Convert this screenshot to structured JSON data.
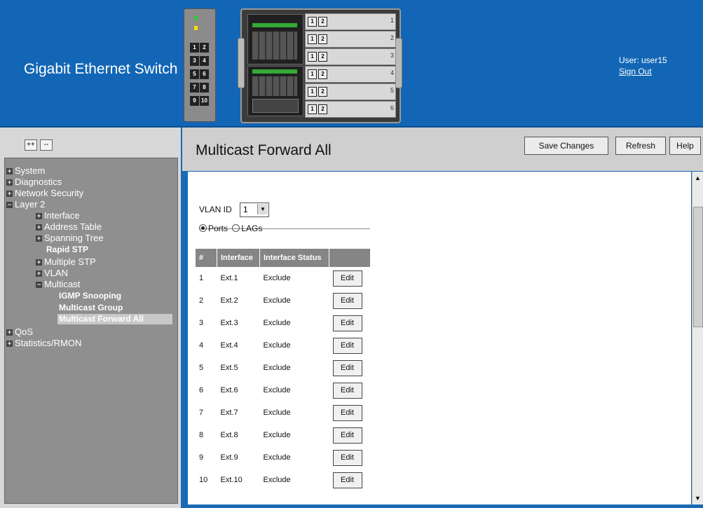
{
  "header": {
    "title": "Gigabit Ethernet Switch",
    "user_label": "User: user15",
    "sign_out": "Sign Out"
  },
  "switch_module": {
    "port_numbers": [
      "1",
      "2",
      "3",
      "4",
      "5",
      "6",
      "7",
      "8",
      "9",
      "10"
    ],
    "slot_numbers": [
      "1",
      "2",
      "3",
      "4",
      "5",
      "6"
    ]
  },
  "sidebar": {
    "expand_all": "++",
    "collapse_all": "--",
    "items": [
      {
        "label": "System",
        "sign": "+"
      },
      {
        "label": "Diagnostics",
        "sign": "+"
      },
      {
        "label": "Network Security",
        "sign": "+"
      },
      {
        "label": "Layer 2",
        "sign": "−"
      },
      {
        "label": "Interface",
        "sign": "+"
      },
      {
        "label": "Address Table",
        "sign": "+"
      },
      {
        "label": "Spanning Tree",
        "sign": "+"
      },
      {
        "label": "Rapid STP"
      },
      {
        "label": "Multiple STP",
        "sign": "+"
      },
      {
        "label": "VLAN",
        "sign": "+"
      },
      {
        "label": "Multicast",
        "sign": "−"
      },
      {
        "label": "IGMP Snooping"
      },
      {
        "label": "Multicast Group"
      },
      {
        "label": "Multicast Forward All"
      },
      {
        "label": "QoS",
        "sign": "+"
      },
      {
        "label": "Statistics/RMON",
        "sign": "+"
      }
    ]
  },
  "main": {
    "title": "Multicast Forward All",
    "buttons": {
      "save": "Save Changes",
      "refresh": "Refresh",
      "help": "Help"
    },
    "vlan_label": "VLAN ID",
    "vlan_value": "1",
    "radio_ports": "Ports",
    "radio_lags": "LAGs",
    "table": {
      "headers": [
        "#",
        "Interface",
        "Interface Status",
        ""
      ],
      "edit_label": "Edit",
      "rows": [
        {
          "num": "1",
          "iface": "Ext.1",
          "status": "Exclude"
        },
        {
          "num": "2",
          "iface": "Ext.2",
          "status": "Exclude"
        },
        {
          "num": "3",
          "iface": "Ext.3",
          "status": "Exclude"
        },
        {
          "num": "4",
          "iface": "Ext.4",
          "status": "Exclude"
        },
        {
          "num": "5",
          "iface": "Ext.5",
          "status": "Exclude"
        },
        {
          "num": "6",
          "iface": "Ext.6",
          "status": "Exclude"
        },
        {
          "num": "7",
          "iface": "Ext.7",
          "status": "Exclude"
        },
        {
          "num": "8",
          "iface": "Ext.8",
          "status": "Exclude"
        },
        {
          "num": "9",
          "iface": "Ext.9",
          "status": "Exclude"
        },
        {
          "num": "10",
          "iface": "Ext.10",
          "status": "Exclude"
        }
      ]
    }
  },
  "colors": {
    "header_bg": "#1266b5",
    "nav_bg": "#8f8f8f",
    "table_header_bg": "#858585"
  }
}
